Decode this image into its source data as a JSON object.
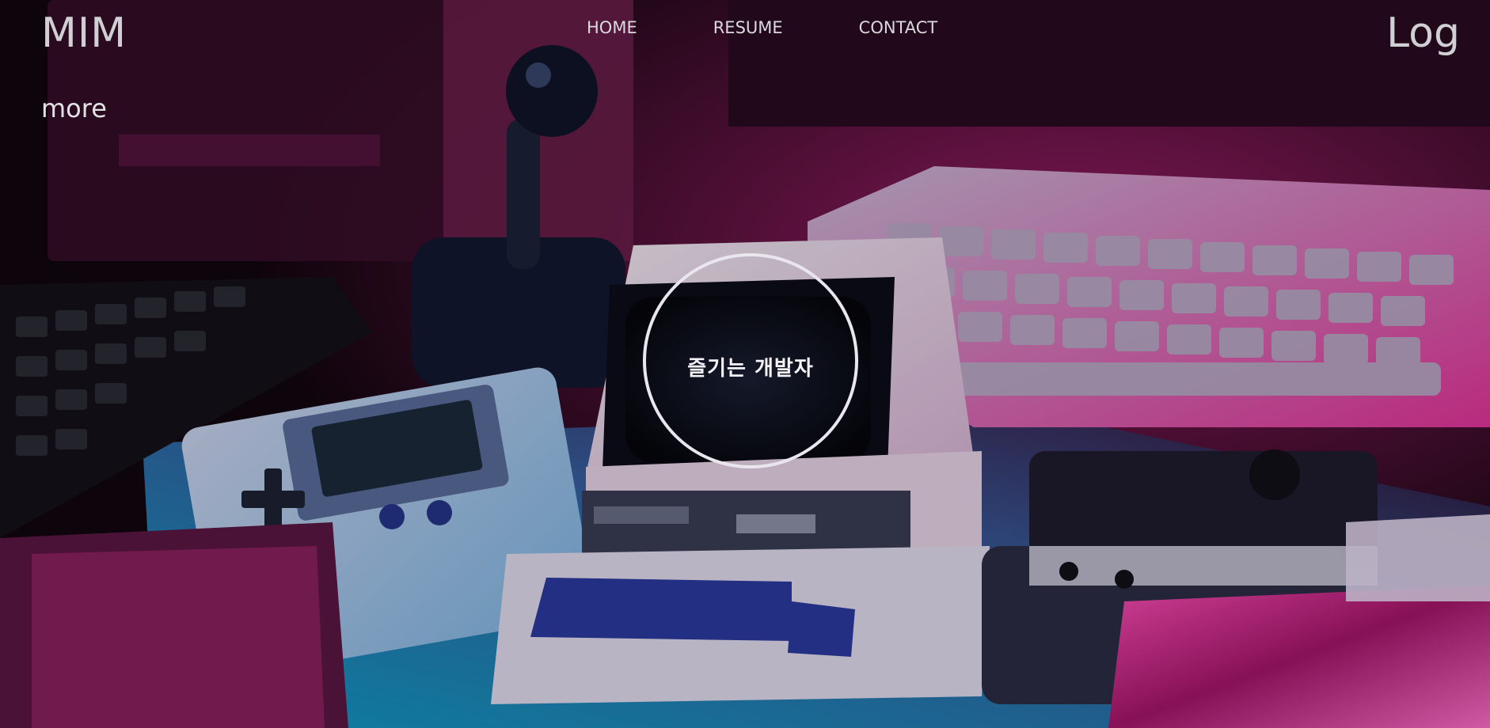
{
  "header": {
    "brand": "MIM",
    "nav": [
      {
        "label": "HOME"
      },
      {
        "label": "RESUME"
      },
      {
        "label": "CONTACT"
      }
    ],
    "log_label": "Log"
  },
  "hero": {
    "more_label": "more",
    "circle_text": "즐기는 개발자"
  },
  "colors": {
    "nav_text": "#d9d9de",
    "circle_border": "#e9e6ee",
    "accent_pink": "#d21d74",
    "accent_cyan": "#23c3f0"
  }
}
